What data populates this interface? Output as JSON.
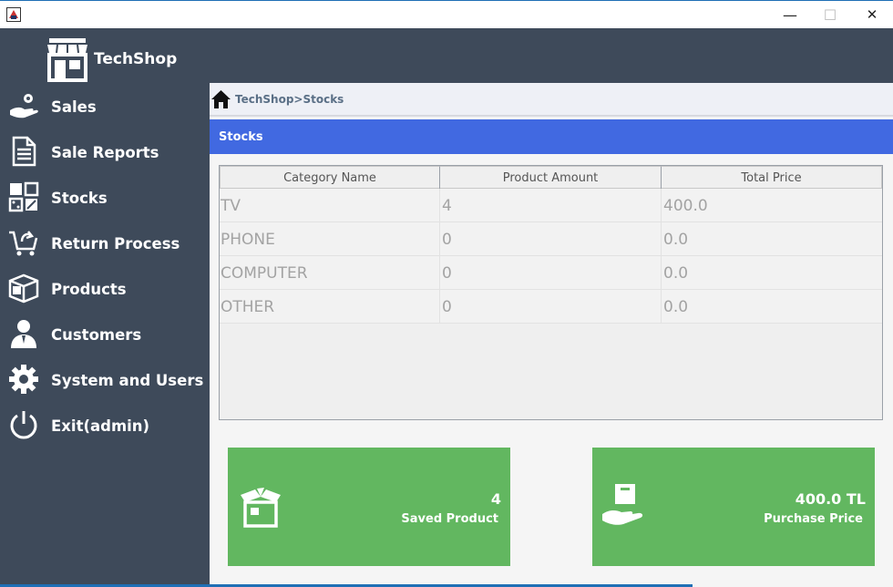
{
  "window": {
    "minimize_glyph": "—",
    "maximize_glyph": "☐",
    "close_glyph": "✕"
  },
  "brand": {
    "name": "TechShop",
    "icon": "store-icon"
  },
  "sidebar": {
    "items": [
      {
        "label": "Sales",
        "icon": "hand-coin-icon"
      },
      {
        "label": "Sale Reports",
        "icon": "document-icon"
      },
      {
        "label": "Stocks",
        "icon": "grid-icon"
      },
      {
        "label": "Return Process",
        "icon": "cart-return-icon"
      },
      {
        "label": "Products",
        "icon": "box-icon"
      },
      {
        "label": "Customers",
        "icon": "user-icon"
      },
      {
        "label": "System and Users",
        "icon": "gear-icon"
      },
      {
        "label": "Exit(admin)",
        "icon": "power-icon"
      }
    ]
  },
  "breadcrumb": {
    "text": "TechShop>Stocks",
    "icon": "home-icon"
  },
  "section": {
    "title": "Stocks"
  },
  "table": {
    "columns": [
      "Category Name",
      "Product Amount",
      "Total Price"
    ],
    "rows": [
      [
        "TV",
        "4",
        "400.0"
      ],
      [
        "PHONE",
        "0",
        "0.0"
      ],
      [
        "COMPUTER",
        "0",
        "0.0"
      ],
      [
        "OTHER",
        "0",
        "0.0"
      ]
    ]
  },
  "cards": [
    {
      "value": "4",
      "label": "Saved Product",
      "icon": "open-box-icon"
    },
    {
      "value": "400.0 TL",
      "label": "Purchase Price",
      "icon": "hand-box-icon"
    }
  ],
  "colors": {
    "sidebar": "#3e4a5a",
    "section_bar": "#4169e1",
    "card": "#62b760"
  }
}
